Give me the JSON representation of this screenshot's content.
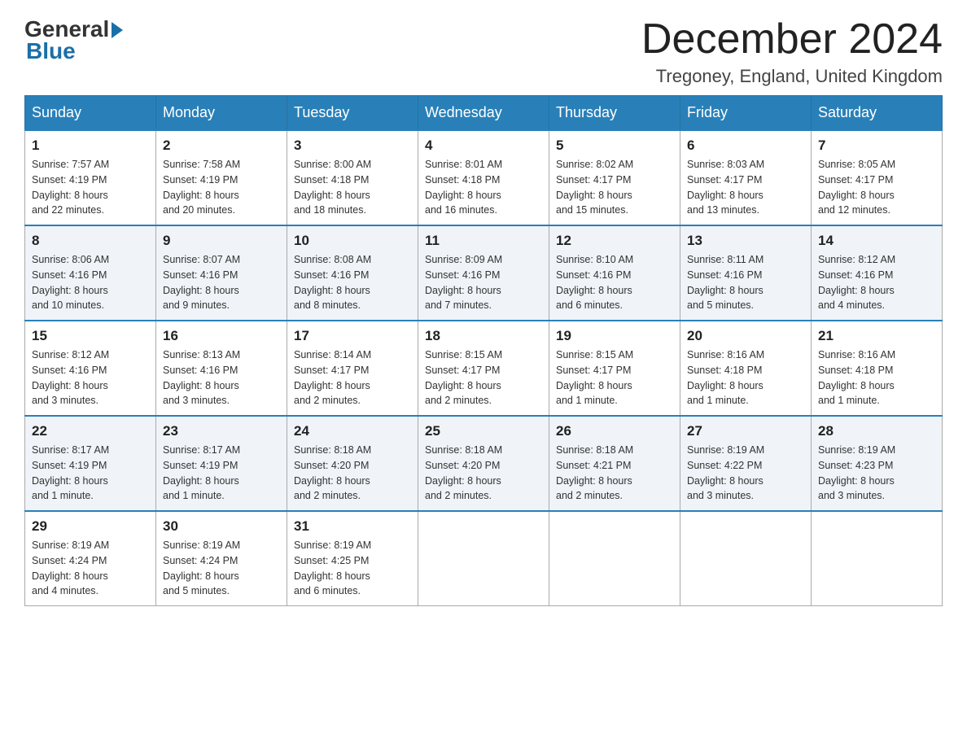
{
  "header": {
    "logo": {
      "general": "General",
      "blue": "Blue"
    },
    "title": "December 2024",
    "location": "Tregoney, England, United Kingdom"
  },
  "days_of_week": [
    "Sunday",
    "Monday",
    "Tuesday",
    "Wednesday",
    "Thursday",
    "Friday",
    "Saturday"
  ],
  "weeks": [
    [
      {
        "day": "1",
        "sunrise": "7:57 AM",
        "sunset": "4:19 PM",
        "daylight": "8 hours and 22 minutes."
      },
      {
        "day": "2",
        "sunrise": "7:58 AM",
        "sunset": "4:19 PM",
        "daylight": "8 hours and 20 minutes."
      },
      {
        "day": "3",
        "sunrise": "8:00 AM",
        "sunset": "4:18 PM",
        "daylight": "8 hours and 18 minutes."
      },
      {
        "day": "4",
        "sunrise": "8:01 AM",
        "sunset": "4:18 PM",
        "daylight": "8 hours and 16 minutes."
      },
      {
        "day": "5",
        "sunrise": "8:02 AM",
        "sunset": "4:17 PM",
        "daylight": "8 hours and 15 minutes."
      },
      {
        "day": "6",
        "sunrise": "8:03 AM",
        "sunset": "4:17 PM",
        "daylight": "8 hours and 13 minutes."
      },
      {
        "day": "7",
        "sunrise": "8:05 AM",
        "sunset": "4:17 PM",
        "daylight": "8 hours and 12 minutes."
      }
    ],
    [
      {
        "day": "8",
        "sunrise": "8:06 AM",
        "sunset": "4:16 PM",
        "daylight": "8 hours and 10 minutes."
      },
      {
        "day": "9",
        "sunrise": "8:07 AM",
        "sunset": "4:16 PM",
        "daylight": "8 hours and 9 minutes."
      },
      {
        "day": "10",
        "sunrise": "8:08 AM",
        "sunset": "4:16 PM",
        "daylight": "8 hours and 8 minutes."
      },
      {
        "day": "11",
        "sunrise": "8:09 AM",
        "sunset": "4:16 PM",
        "daylight": "8 hours and 7 minutes."
      },
      {
        "day": "12",
        "sunrise": "8:10 AM",
        "sunset": "4:16 PM",
        "daylight": "8 hours and 6 minutes."
      },
      {
        "day": "13",
        "sunrise": "8:11 AM",
        "sunset": "4:16 PM",
        "daylight": "8 hours and 5 minutes."
      },
      {
        "day": "14",
        "sunrise": "8:12 AM",
        "sunset": "4:16 PM",
        "daylight": "8 hours and 4 minutes."
      }
    ],
    [
      {
        "day": "15",
        "sunrise": "8:12 AM",
        "sunset": "4:16 PM",
        "daylight": "8 hours and 3 minutes."
      },
      {
        "day": "16",
        "sunrise": "8:13 AM",
        "sunset": "4:16 PM",
        "daylight": "8 hours and 3 minutes."
      },
      {
        "day": "17",
        "sunrise": "8:14 AM",
        "sunset": "4:17 PM",
        "daylight": "8 hours and 2 minutes."
      },
      {
        "day": "18",
        "sunrise": "8:15 AM",
        "sunset": "4:17 PM",
        "daylight": "8 hours and 2 minutes."
      },
      {
        "day": "19",
        "sunrise": "8:15 AM",
        "sunset": "4:17 PM",
        "daylight": "8 hours and 1 minute."
      },
      {
        "day": "20",
        "sunrise": "8:16 AM",
        "sunset": "4:18 PM",
        "daylight": "8 hours and 1 minute."
      },
      {
        "day": "21",
        "sunrise": "8:16 AM",
        "sunset": "4:18 PM",
        "daylight": "8 hours and 1 minute."
      }
    ],
    [
      {
        "day": "22",
        "sunrise": "8:17 AM",
        "sunset": "4:19 PM",
        "daylight": "8 hours and 1 minute."
      },
      {
        "day": "23",
        "sunrise": "8:17 AM",
        "sunset": "4:19 PM",
        "daylight": "8 hours and 1 minute."
      },
      {
        "day": "24",
        "sunrise": "8:18 AM",
        "sunset": "4:20 PM",
        "daylight": "8 hours and 2 minutes."
      },
      {
        "day": "25",
        "sunrise": "8:18 AM",
        "sunset": "4:20 PM",
        "daylight": "8 hours and 2 minutes."
      },
      {
        "day": "26",
        "sunrise": "8:18 AM",
        "sunset": "4:21 PM",
        "daylight": "8 hours and 2 minutes."
      },
      {
        "day": "27",
        "sunrise": "8:19 AM",
        "sunset": "4:22 PM",
        "daylight": "8 hours and 3 minutes."
      },
      {
        "day": "28",
        "sunrise": "8:19 AM",
        "sunset": "4:23 PM",
        "daylight": "8 hours and 3 minutes."
      }
    ],
    [
      {
        "day": "29",
        "sunrise": "8:19 AM",
        "sunset": "4:24 PM",
        "daylight": "8 hours and 4 minutes."
      },
      {
        "day": "30",
        "sunrise": "8:19 AM",
        "sunset": "4:24 PM",
        "daylight": "8 hours and 5 minutes."
      },
      {
        "day": "31",
        "sunrise": "8:19 AM",
        "sunset": "4:25 PM",
        "daylight": "8 hours and 6 minutes."
      },
      null,
      null,
      null,
      null
    ]
  ],
  "labels": {
    "sunrise": "Sunrise:",
    "sunset": "Sunset:",
    "daylight": "Daylight:"
  }
}
